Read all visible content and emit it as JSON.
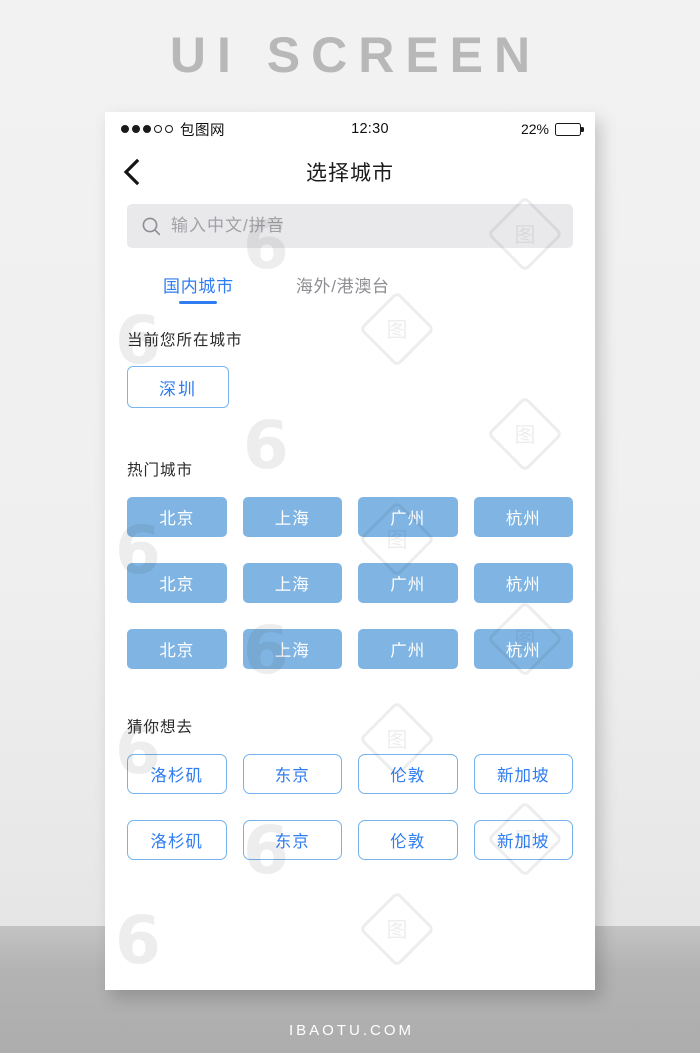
{
  "poster": {
    "heading": "UI SCREEN",
    "footer": "IBAOTU.COM"
  },
  "status_bar": {
    "carrier": "包图网",
    "time": "12:30",
    "battery_percent": "22%",
    "signal_filled": 3,
    "signal_total": 5,
    "battery_level": 22
  },
  "nav": {
    "back_icon": "chevron-left-icon",
    "title": "选择城市"
  },
  "search": {
    "icon": "search-icon",
    "value": "",
    "placeholder": "输入中文/拼音"
  },
  "tabs": [
    {
      "label": "国内城市",
      "active": true
    },
    {
      "label": "海外/港澳台",
      "active": false
    }
  ],
  "sections": {
    "current": {
      "label": "当前您所在城市",
      "city": "深圳"
    },
    "hot": {
      "label": "热门城市",
      "cities": [
        "北京",
        "上海",
        "广州",
        "杭州",
        "北京",
        "上海",
        "广州",
        "杭州",
        "北京",
        "上海",
        "广州",
        "杭州"
      ]
    },
    "guess": {
      "label": "猜你想去",
      "cities": [
        "洛杉矶",
        "东京",
        "伦敦",
        "新加坡",
        "洛杉矶",
        "东京",
        "伦敦",
        "新加坡"
      ]
    }
  },
  "colors": {
    "accent_blue": "#2f7df0",
    "chip_fill": "#7fb4e3",
    "chip_border": "#79b5ef",
    "muted_text": "#8e8e93",
    "search_bg": "#e9e9ec",
    "heading_gray": "#b8b8b8"
  },
  "watermark": {
    "text": "包图网",
    "mark": "6"
  }
}
